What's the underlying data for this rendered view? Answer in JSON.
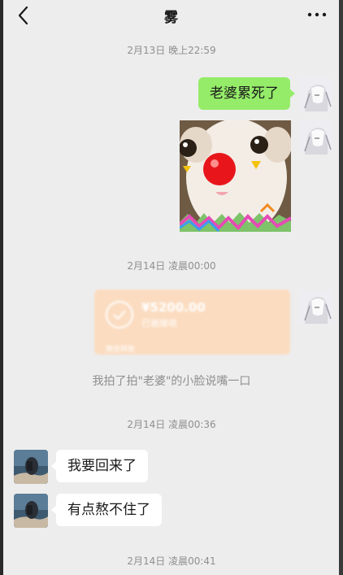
{
  "header": {
    "title": "雾"
  },
  "timestamps": {
    "t1": "2月13日 晚上22:59",
    "t2": "2月14日 凌晨00:00",
    "t3": "2月14日 凌晨00:36",
    "t4": "2月14日 凌晨00:41"
  },
  "messages": {
    "m1": "老婆累死了",
    "m2": "我要回来了",
    "m3": "有点熬不住了"
  },
  "transfer": {
    "amount": "¥5200.00",
    "status": "已被接收",
    "footer": "微信转账"
  },
  "system": {
    "pat": "我拍了拍\"老婆\"的小脸说嘴一口"
  },
  "colors": {
    "bubble_self": "#95ec69",
    "bubble_other": "#ffffff",
    "transfer_bg": "#fbdcc0",
    "background": "#ededed"
  },
  "icons": {
    "back": "chevron-left-icon",
    "more": "more-dots-icon",
    "transfer": "check-circle-icon"
  }
}
